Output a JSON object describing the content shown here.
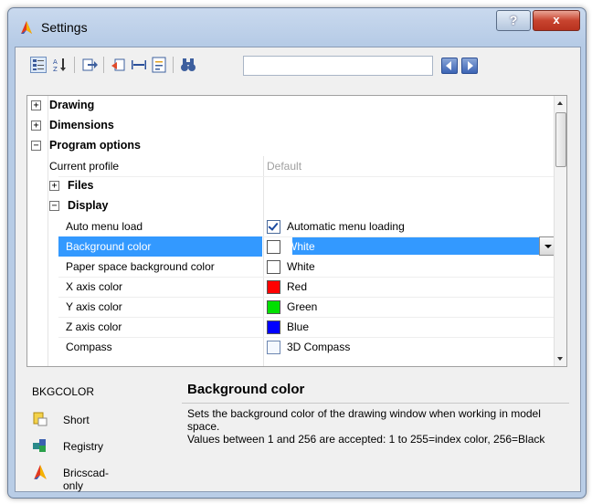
{
  "window": {
    "title": "Settings"
  },
  "titlebar": {
    "help_label": "?",
    "close_label": "x"
  },
  "toolbar": {
    "search_value": ""
  },
  "grid": {
    "categories": [
      {
        "label": "Drawing",
        "expander": "+"
      },
      {
        "label": "Dimensions",
        "expander": "+"
      },
      {
        "label": "Program options",
        "expander": "−"
      }
    ],
    "current_profile": {
      "name": "Current profile",
      "value": "Default"
    },
    "files": {
      "label": "Files",
      "expander": "+"
    },
    "display": {
      "label": "Display",
      "expander": "−"
    },
    "props": [
      {
        "name": "Auto menu load",
        "value": "Automatic menu loading"
      },
      {
        "name": "Background color",
        "value": "White",
        "color": "#ffffff"
      },
      {
        "name": "Paper space background color",
        "value": "White",
        "color": "#ffffff"
      },
      {
        "name": "X axis color",
        "value": "Red",
        "color": "#ff0000"
      },
      {
        "name": "Y axis color",
        "value": "Green",
        "color": "#00e000"
      },
      {
        "name": "Z axis color",
        "value": "Blue",
        "color": "#0000ff"
      },
      {
        "name": "Compass",
        "value": "3D Compass"
      }
    ]
  },
  "info": {
    "variable": "BKGCOLOR",
    "flags": [
      "Short",
      "Registry",
      "Bricscad-only"
    ],
    "title": "Background color",
    "description_1": "Sets the background color of the drawing window when working in model space.",
    "description_2": "Values between 1 and 256 are accepted: 1 to 255=index color, 256=Black"
  }
}
